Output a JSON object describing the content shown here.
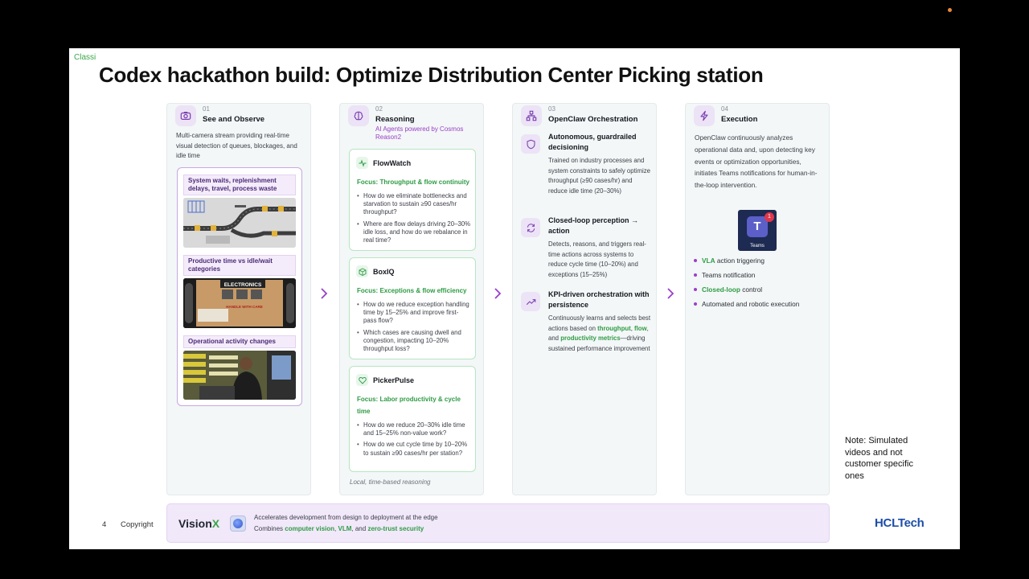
{
  "slide": {
    "classification": "Classi",
    "title": "Codex hackathon build: Optimize Distribution Center Picking station",
    "page_number": "4",
    "copyright": "Copyright",
    "note": "Note: Simulated videos and not customer specific ones",
    "company": "HCLTech"
  },
  "colors": {
    "accent_purple": "#9b3fc7",
    "accent_green": "#2f9b45",
    "brand_blue": "#1d4ea8"
  },
  "see_observe": {
    "num": "01",
    "title": "See and Observe",
    "icon": "camera-icon",
    "desc": "Multi-camera stream providing real-time visual detection of queues, blockages, and idle time",
    "tags": [
      "System waits, replenishment delays, travel, process waste",
      "Productive time vs idle/wait categories",
      "Operational activity changes"
    ],
    "electronics_label": "ELECTRONICS",
    "handle_label": "HANDLE WITH CARE"
  },
  "reasoning": {
    "num": "02",
    "title": "Reasoning",
    "subtitle": "AI Agents powered by Cosmos Reason2",
    "icon": "brain-icon",
    "footer_note": "Local, time-based reasoning",
    "agents": [
      {
        "name": "FlowWatch",
        "focus": "Focus: Throughput & flow continuity",
        "points": [
          "How do we eliminate bottlenecks and starvation to sustain ≥90 cases/hr throughput?",
          "Where are flow delays driving 20–30% idle loss, and how do we rebalance in real time?"
        ]
      },
      {
        "name": "BoxIQ",
        "focus": "Focus: Exceptions & flow efficiency",
        "points": [
          "How do we reduce exception handling time by 15–25% and improve first-pass flow?",
          "Which cases are causing dwell and congestion, impacting 10–20% throughput loss?"
        ]
      },
      {
        "name": "PickerPulse",
        "focus": "Focus: Labor productivity & cycle time",
        "points": [
          "How do we reduce 20–30% idle time and 15–25% non-value work?",
          "How do we cut cycle time by 10–20% to sustain ≥90 cases/hr per station?"
        ]
      }
    ]
  },
  "orchestration": {
    "num": "03",
    "title": "OpenClaw Orchestration",
    "icon": "network-icon",
    "items": [
      {
        "icon": "shield-icon",
        "title": "Autonomous, guardrailed decisioning",
        "desc": "Trained on industry processes and system constraints to safely optimize throughput (≥90 cases/hr) and reduce idle time (20–30%)"
      },
      {
        "icon": "loop-icon",
        "title": "Closed-loop perception → action",
        "desc": "Detects, reasons, and triggers real-time actions across systems to reduce cycle time (10–20%) and exceptions (15–25%)"
      },
      {
        "icon": "trend-icon",
        "title": "KPI-driven orchestration with persistence",
        "desc_pre": "Continuously learns and selects best actions based on",
        "desc_g1": "throughput",
        "desc_c1": ",",
        "desc_g2": "flow",
        "desc_c2": ", and",
        "desc_g3": "productivity metrics",
        "desc_post": "—driving sustained performance improvement"
      }
    ]
  },
  "execution": {
    "num": "04",
    "title": "Execution",
    "icon": "lightning-icon",
    "desc": "OpenClaw continuously analyzes operational data and, upon detecting key events or optimization opportunities, initiates Teams notifications for human-in-the-loop intervention.",
    "teams_label": "Teams",
    "teams_badge": "1",
    "teams_letter": "T",
    "bullets": [
      {
        "hl": "VLA",
        "rest": " action triggering"
      },
      {
        "hl": "",
        "rest": "Teams notification"
      },
      {
        "hl": "Closed-loop",
        "rest": " control"
      },
      {
        "hl": "",
        "rest": "Automated and robotic execution"
      }
    ]
  },
  "footer": {
    "brand_main": "Vision",
    "brand_x": "X",
    "line1": "Accelerates development from design to deployment at the edge",
    "line2_pre": "Combines",
    "line2_g1": "computer vision",
    "line2_c1": ",",
    "line2_g2": "VLM",
    "line2_c2": ", and",
    "line2_g3": "zero-trust security"
  }
}
